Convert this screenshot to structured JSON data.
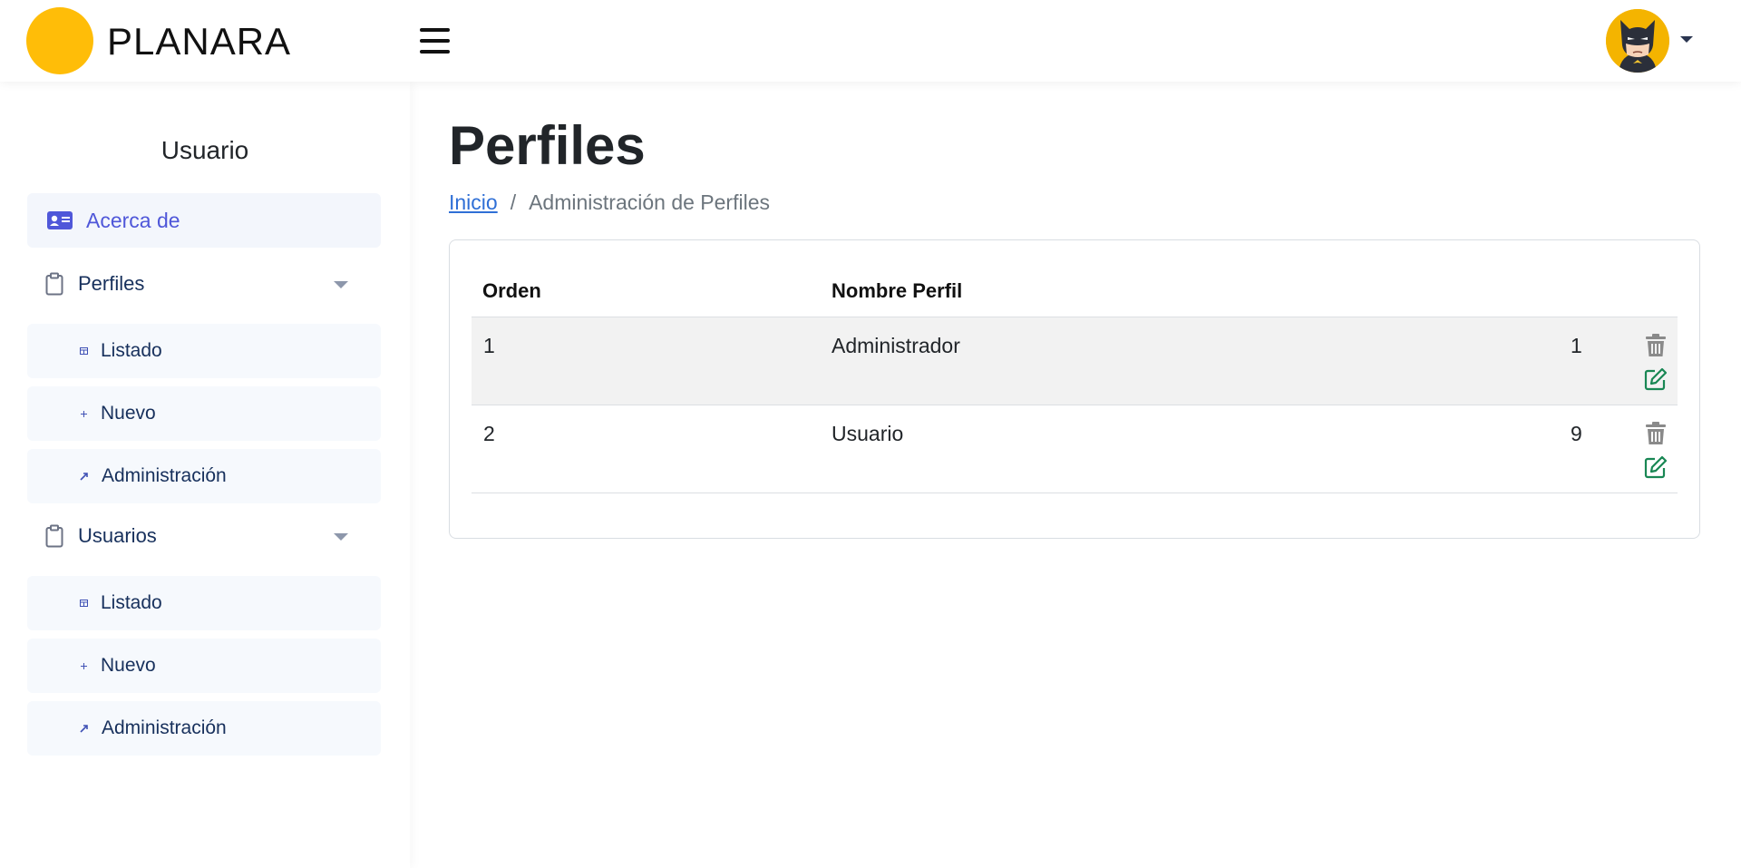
{
  "header": {
    "brand": "PLANARA",
    "colors": {
      "logo": "#ffbd08",
      "accent": "#4f57d9",
      "edit": "#198754",
      "delete": "#8a8a8a"
    }
  },
  "sidebar": {
    "title": "Usuario",
    "items": [
      {
        "label": "Acerca de",
        "icon": "id-card-icon"
      },
      {
        "label": "Perfiles",
        "icon": "clipboard-icon"
      },
      {
        "label": "Listado",
        "icon": "table-icon"
      },
      {
        "label": "Nuevo",
        "icon": "plus-icon"
      },
      {
        "label": "Administración",
        "icon": "arrow-icon"
      },
      {
        "label": "Usuarios",
        "icon": "clipboard-icon"
      },
      {
        "label": "Listado",
        "icon": "table-icon"
      },
      {
        "label": "Nuevo",
        "icon": "plus-icon"
      },
      {
        "label": "Administración",
        "icon": "arrow-icon"
      }
    ]
  },
  "main": {
    "title": "Perfiles",
    "breadcrumb": {
      "home": "Inicio",
      "separator": "/",
      "current": "Administración de Perfiles"
    },
    "table": {
      "headers": [
        "Orden",
        "Nombre Perfil"
      ],
      "rows": [
        {
          "orden": "1",
          "nombre": "Administrador",
          "count": "1"
        },
        {
          "orden": "2",
          "nombre": "Usuario",
          "count": "9"
        }
      ]
    }
  }
}
